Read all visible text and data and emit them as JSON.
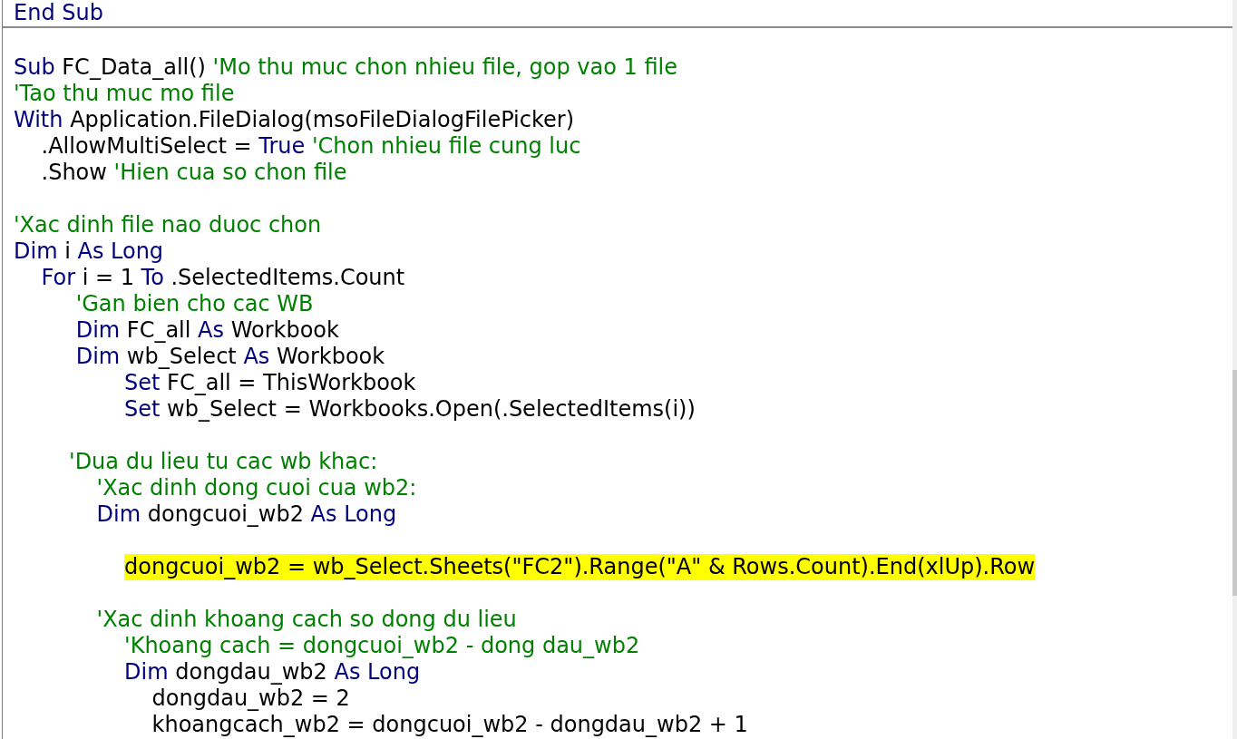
{
  "procedures": [
    {
      "lines": [
        {
          "kind": "code",
          "highlighted": false,
          "tokens": [
            {
              "kind": "keyword",
              "text": "End Sub"
            }
          ]
        }
      ]
    },
    {
      "lines": [
        {
          "kind": "blank"
        },
        {
          "kind": "code",
          "highlighted": false,
          "tokens": [
            {
              "kind": "keyword",
              "text": "Sub"
            },
            {
              "kind": "plain",
              "text": " FC_Data_all() "
            },
            {
              "kind": "comment",
              "text": "'Mo thu muc chon nhieu file, gop vao 1 file"
            }
          ]
        },
        {
          "kind": "code",
          "highlighted": false,
          "tokens": [
            {
              "kind": "comment",
              "text": "'Tao thu muc mo file"
            }
          ]
        },
        {
          "kind": "code",
          "highlighted": false,
          "tokens": [
            {
              "kind": "keyword",
              "text": "With"
            },
            {
              "kind": "plain",
              "text": " Application.FileDialog(msoFileDialogFilePicker)"
            }
          ]
        },
        {
          "kind": "code",
          "highlighted": false,
          "tokens": [
            {
              "kind": "plain",
              "text": "    .AllowMultiSelect = "
            },
            {
              "kind": "keyword",
              "text": "True"
            },
            {
              "kind": "comment",
              "text": " 'Chon nhieu file cung luc"
            }
          ]
        },
        {
          "kind": "code",
          "highlighted": false,
          "tokens": [
            {
              "kind": "plain",
              "text": "    .Show "
            },
            {
              "kind": "comment",
              "text": "'Hien cua so chon file"
            }
          ]
        },
        {
          "kind": "blank"
        },
        {
          "kind": "code",
          "highlighted": false,
          "tokens": [
            {
              "kind": "comment",
              "text": "'Xac dinh file nao duoc chon"
            }
          ]
        },
        {
          "kind": "code",
          "highlighted": false,
          "tokens": [
            {
              "kind": "keyword",
              "text": "Dim"
            },
            {
              "kind": "plain",
              "text": " i "
            },
            {
              "kind": "keyword",
              "text": "As Long"
            }
          ]
        },
        {
          "kind": "code",
          "highlighted": false,
          "tokens": [
            {
              "kind": "keyword",
              "text": "    For"
            },
            {
              "kind": "plain",
              "text": " i = 1 "
            },
            {
              "kind": "keyword",
              "text": "To"
            },
            {
              "kind": "plain",
              "text": " .SelectedItems.Count"
            }
          ]
        },
        {
          "kind": "code",
          "highlighted": false,
          "tokens": [
            {
              "kind": "comment",
              "text": "         'Gan bien cho cac WB"
            }
          ]
        },
        {
          "kind": "code",
          "highlighted": false,
          "tokens": [
            {
              "kind": "keyword",
              "text": "         Dim"
            },
            {
              "kind": "plain",
              "text": " FC_all "
            },
            {
              "kind": "keyword",
              "text": "As"
            },
            {
              "kind": "plain",
              "text": " Workbook"
            }
          ]
        },
        {
          "kind": "code",
          "highlighted": false,
          "tokens": [
            {
              "kind": "keyword",
              "text": "         Dim"
            },
            {
              "kind": "plain",
              "text": " wb_Select "
            },
            {
              "kind": "keyword",
              "text": "As"
            },
            {
              "kind": "plain",
              "text": " Workbook"
            }
          ]
        },
        {
          "kind": "code",
          "highlighted": false,
          "tokens": [
            {
              "kind": "keyword",
              "text": "                Set"
            },
            {
              "kind": "plain",
              "text": " FC_all = ThisWorkbook"
            }
          ]
        },
        {
          "kind": "code",
          "highlighted": false,
          "tokens": [
            {
              "kind": "keyword",
              "text": "                Set"
            },
            {
              "kind": "plain",
              "text": " wb_Select = Workbooks.Open(.SelectedItems(i))"
            }
          ]
        },
        {
          "kind": "blank"
        },
        {
          "kind": "code",
          "highlighted": false,
          "tokens": [
            {
              "kind": "comment",
              "text": "        'Dua du lieu tu cac wb khac:"
            }
          ]
        },
        {
          "kind": "code",
          "highlighted": false,
          "tokens": [
            {
              "kind": "comment",
              "text": "            'Xac dinh dong cuoi cua wb2:"
            }
          ]
        },
        {
          "kind": "code",
          "highlighted": false,
          "tokens": [
            {
              "kind": "keyword",
              "text": "            Dim"
            },
            {
              "kind": "plain",
              "text": " dongcuoi_wb2 "
            },
            {
              "kind": "keyword",
              "text": "As Long"
            }
          ]
        },
        {
          "kind": "blank"
        },
        {
          "kind": "code",
          "highlighted": true,
          "tokens": [
            {
              "kind": "plain",
              "text": "                dongcuoi_wb2 = wb_Select.Sheets(\"FC2\").Range(\"A\" & Rows.Count).End(xlUp).Row"
            }
          ]
        },
        {
          "kind": "blank"
        },
        {
          "kind": "code",
          "highlighted": false,
          "tokens": [
            {
              "kind": "comment",
              "text": "            'Xac dinh khoang cach so dong du lieu"
            }
          ]
        },
        {
          "kind": "code",
          "highlighted": false,
          "tokens": [
            {
              "kind": "comment",
              "text": "                'Khoang cach = dongcuoi_wb2 - dong dau_wb2"
            }
          ]
        },
        {
          "kind": "code",
          "highlighted": false,
          "tokens": [
            {
              "kind": "keyword",
              "text": "                Dim"
            },
            {
              "kind": "plain",
              "text": " dongdau_wb2 "
            },
            {
              "kind": "keyword",
              "text": "As Long"
            }
          ]
        },
        {
          "kind": "code",
          "highlighted": false,
          "tokens": [
            {
              "kind": "plain",
              "text": "                    dongdau_wb2 = 2"
            }
          ]
        },
        {
          "kind": "code",
          "highlighted": false,
          "tokens": [
            {
              "kind": "plain",
              "text": "                    khoangcach_wb2 = dongcuoi_wb2 - dongdau_wb2 + 1"
            }
          ]
        }
      ]
    }
  ]
}
